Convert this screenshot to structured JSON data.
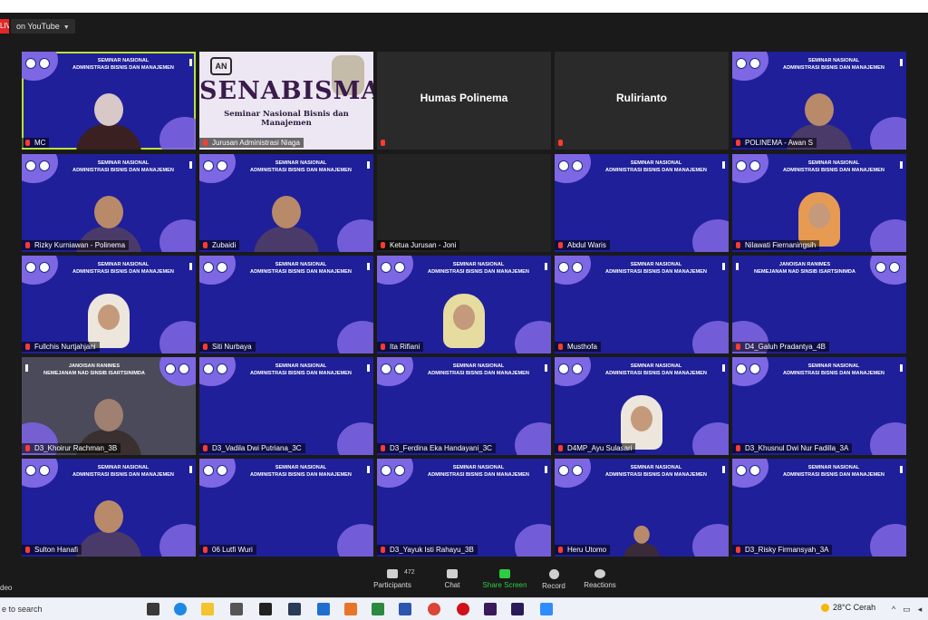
{
  "topbar": {
    "live_label": "LIVE",
    "stream_label": "on YouTube"
  },
  "banner": {
    "line1": "SEMINAR NASIONAL",
    "line2": "ADMINISTRASI BISNIS DAN MANAJEMEN",
    "line1_mirror": "JANOISAN RANIMES",
    "line2_mirror": "NEMEJANAM NAD SINSIB ISARTSINIMDA"
  },
  "senabisma": {
    "logo": "AN",
    "title": "SENABISMA",
    "subtitle": "Seminar Nasional Bisnis dan Manajemen"
  },
  "tiles": [
    {
      "kind": "video",
      "name": "MC",
      "person": "mc",
      "active": true
    },
    {
      "kind": "senabisma",
      "name": "Jurusan Administrasi Niaga"
    },
    {
      "kind": "name",
      "name": "Humas Polinema"
    },
    {
      "kind": "name",
      "name": "Rulirianto"
    },
    {
      "kind": "video",
      "name": "POLINEMA - Awan S",
      "person": "man"
    },
    {
      "kind": "video",
      "name": "Rizky Kurniawan - Polinema",
      "person": "man"
    },
    {
      "kind": "video",
      "name": "Zubaidi",
      "person": "man"
    },
    {
      "kind": "off",
      "name": "Ketua Jurusan - Joni"
    },
    {
      "kind": "video",
      "name": "Abdul Waris",
      "person": "none"
    },
    {
      "kind": "video",
      "name": "Nilawati Fiernaningsih",
      "person": "hijab-orange"
    },
    {
      "kind": "video",
      "name": "Fullchis Nurtjahjani",
      "person": "hijab-white"
    },
    {
      "kind": "video",
      "name": "Siti Nurbaya",
      "person": "none"
    },
    {
      "kind": "video",
      "name": "Ita Rifiani",
      "person": "hijab-cream"
    },
    {
      "kind": "video",
      "name": "Musthofa",
      "person": "none"
    },
    {
      "kind": "mirror",
      "name": "D4_Galuh Pradantya_4B",
      "person": "none"
    },
    {
      "kind": "mirror-grey",
      "name": "D3_Khoirur Rachman_3B",
      "person": "woman-dim"
    },
    {
      "kind": "video",
      "name": "D3_Vadila Dwi Putriana_3C",
      "person": "none"
    },
    {
      "kind": "video",
      "name": "D3_Ferdina Eka Handayani_3C",
      "person": "none"
    },
    {
      "kind": "video",
      "name": "D4MP_Ayu Sulasari",
      "person": "hijab-white"
    },
    {
      "kind": "video",
      "name": "D3_Khusnul Dwi Nur Fadilla_3A",
      "person": "none"
    },
    {
      "kind": "video",
      "name": "Sulton Hanafi",
      "person": "man"
    },
    {
      "kind": "video",
      "name": "06 Lutfi Wuri",
      "person": "none"
    },
    {
      "kind": "video",
      "name": "D3_Yayuk Isti Rahayu_3B",
      "person": "none"
    },
    {
      "kind": "video",
      "name": "Heru Utomo",
      "person": "man-small"
    },
    {
      "kind": "video",
      "name": "D3_Risky Firmansyah_3A",
      "person": "none"
    }
  ],
  "controls": {
    "participants_label": "Participants",
    "participants_count": "472",
    "chat_label": "Chat",
    "share_label": "Share Screen",
    "record_label": "Record",
    "reactions_label": "Reactions",
    "video_label": "deo"
  },
  "taskbar": {
    "search_text": "e to search",
    "weather": "28°C Cerah"
  },
  "colors": {
    "banner_blue": "#1f1f9a",
    "blob_purple": "#7e67e3",
    "share_green": "#2ecc40",
    "active_border": "#b8e23a",
    "mic_red": "#ff3b30"
  }
}
